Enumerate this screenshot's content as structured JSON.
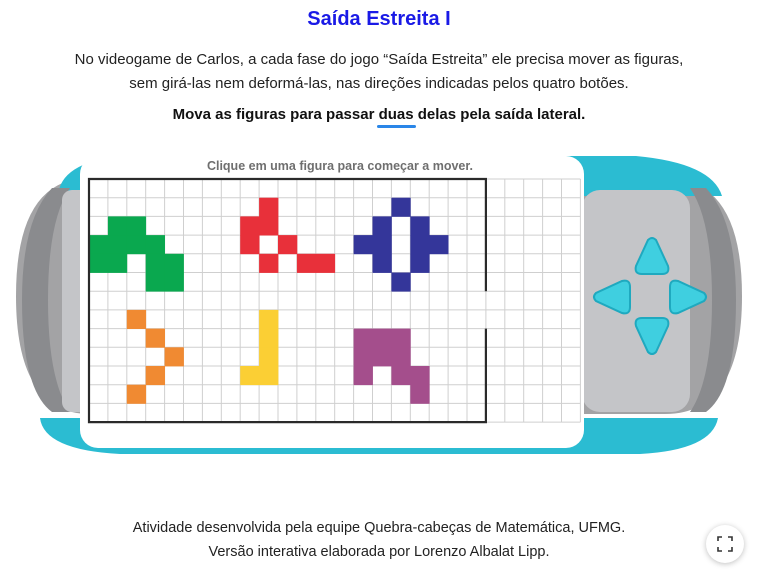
{
  "title": "Saída Estreita I",
  "intro": {
    "line1": "No videogame de Carlos, a cada fase do jogo “Saída Estreita” ele precisa mover as figuras,",
    "line2": "sem girá-las nem deformá-las, nas direções indicadas pelos quatro botões."
  },
  "task": {
    "before": "Mova as figuras para passar ",
    "highlight": "duas",
    "after": " delas pela saída lateral."
  },
  "game": {
    "hint": "Clique em uma figura para começar a mover.",
    "grid_columns": 26,
    "grid_rows": 13,
    "board_columns": 21,
    "exit_rows": [
      6,
      7
    ],
    "figures": [
      {
        "name": "green-figure",
        "color": "#0aa84f",
        "cells": [
          [
            1,
            2
          ],
          [
            2,
            2
          ],
          [
            0,
            3
          ],
          [
            1,
            3
          ],
          [
            2,
            3
          ],
          [
            3,
            3
          ],
          [
            0,
            4
          ],
          [
            1,
            4
          ],
          [
            3,
            4
          ],
          [
            4,
            4
          ],
          [
            3,
            5
          ],
          [
            4,
            5
          ]
        ]
      },
      {
        "name": "red-figure",
        "color": "#e8303a",
        "cells": [
          [
            9,
            1
          ],
          [
            8,
            2
          ],
          [
            9,
            2
          ],
          [
            8,
            3
          ],
          [
            10,
            3
          ],
          [
            9,
            4
          ],
          [
            11,
            4
          ],
          [
            12,
            4
          ]
        ]
      },
      {
        "name": "blue-figure",
        "color": "#34369a",
        "cells": [
          [
            16,
            1
          ],
          [
            15,
            2
          ],
          [
            17,
            2
          ],
          [
            14,
            3
          ],
          [
            15,
            3
          ],
          [
            17,
            3
          ],
          [
            18,
            3
          ],
          [
            15,
            4
          ],
          [
            17,
            4
          ],
          [
            16,
            5
          ]
        ]
      },
      {
        "name": "orange-figure",
        "color": "#f08a32",
        "cells": [
          [
            2,
            7
          ],
          [
            3,
            8
          ],
          [
            4,
            9
          ],
          [
            3,
            10
          ],
          [
            2,
            11
          ]
        ]
      },
      {
        "name": "yellow-figure",
        "color": "#fbcf34",
        "cells": [
          [
            9,
            7
          ],
          [
            9,
            8
          ],
          [
            9,
            9
          ],
          [
            8,
            10
          ],
          [
            9,
            10
          ]
        ]
      },
      {
        "name": "purple-figure",
        "color": "#a44e8c",
        "cells": [
          [
            14,
            8
          ],
          [
            15,
            8
          ],
          [
            16,
            8
          ],
          [
            14,
            9
          ],
          [
            15,
            9
          ],
          [
            16,
            9
          ],
          [
            14,
            10
          ],
          [
            16,
            10
          ],
          [
            17,
            10
          ],
          [
            17,
            11
          ]
        ]
      }
    ]
  },
  "controls": {
    "up_icon": "arrow-up-icon",
    "down_icon": "arrow-down-icon",
    "left_icon": "arrow-left-icon",
    "right_icon": "arrow-right-icon"
  },
  "footer": {
    "line1": "Atividade desenvolvida pela equipe Quebra-cabeças de Matemática, UFMG.",
    "line2": "Versão interativa elaborada por Lorenzo Albalat Lipp."
  },
  "fullscreen_icon": "fullscreen-icon",
  "colors": {
    "title": "#1a1ae6",
    "shell_cyan": "#2bbcd2",
    "shell_gray": "#a3a3a5",
    "dpad": "#3fcfe0"
  }
}
